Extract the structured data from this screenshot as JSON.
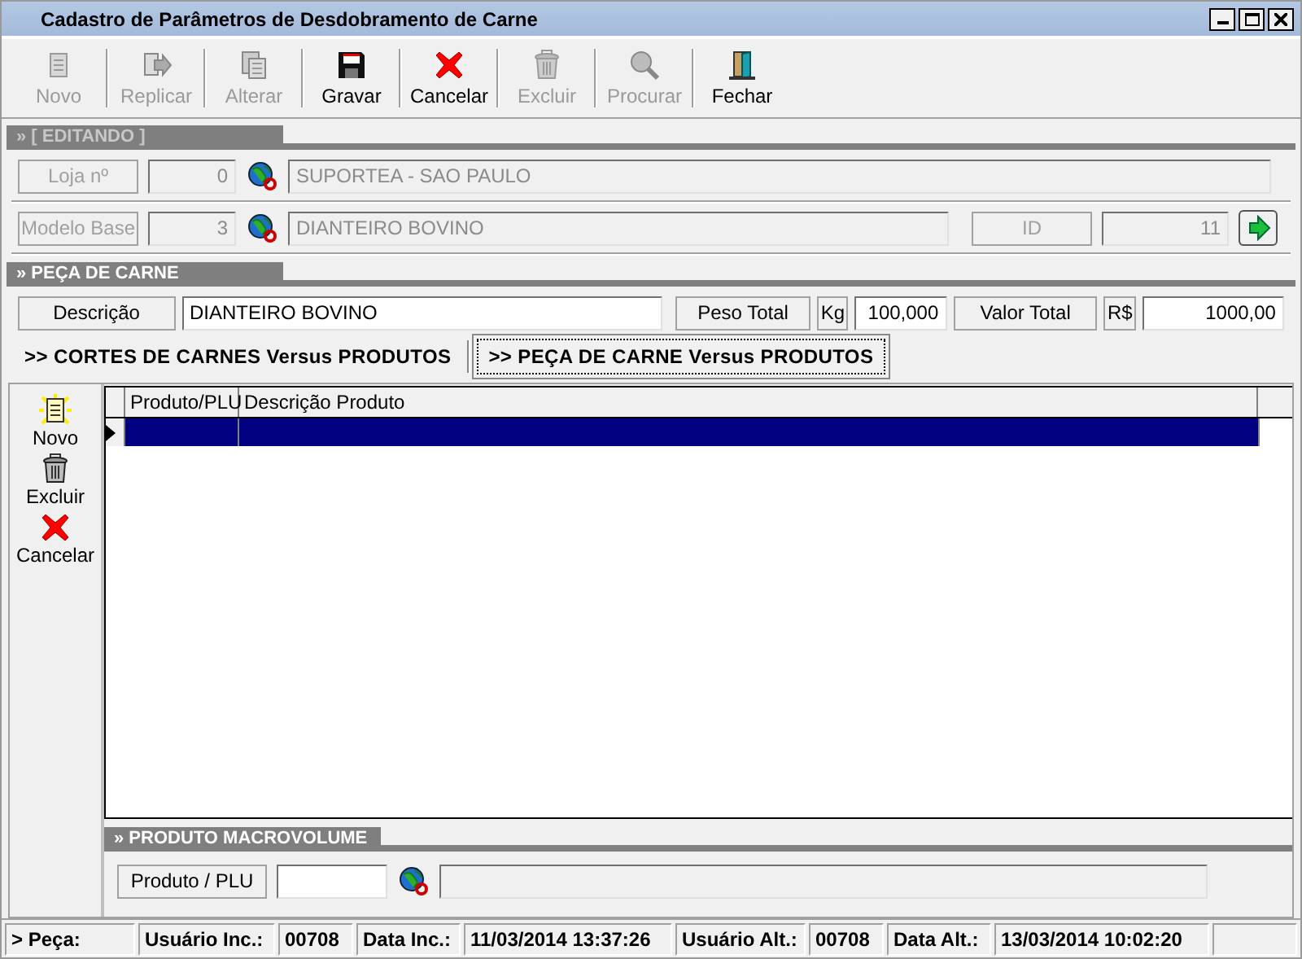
{
  "window": {
    "title": "Cadastro de Parâmetros de Desdobramento de Carne"
  },
  "toolbar": [
    {
      "label": "Novo",
      "disabled": true
    },
    {
      "label": "Replicar",
      "disabled": true
    },
    {
      "label": "Alterar",
      "disabled": true
    },
    {
      "label": "Gravar",
      "disabled": false
    },
    {
      "label": "Cancelar",
      "disabled": false
    },
    {
      "label": "Excluir",
      "disabled": true
    },
    {
      "label": "Procurar",
      "disabled": true
    },
    {
      "label": "Fechar",
      "disabled": false
    }
  ],
  "editing": {
    "title": "» [ EDITANDO ]",
    "disabled": true,
    "store": {
      "label": "Loja nº",
      "code": "0",
      "name": "SUPORTEA - SAO PAULO"
    },
    "model": {
      "label": "Modelo Base",
      "code": "3",
      "name": "DIANTEIRO BOVINO"
    },
    "id": {
      "label": "ID",
      "value": "11"
    }
  },
  "piece": {
    "title": "» PEÇA DE CARNE",
    "items": [
      {
        "kind": "label",
        "text": "Descrição"
      },
      {
        "kind": "field",
        "text": "DIANTEIRO BOVINO"
      },
      {
        "kind": "label",
        "text": "Peso Total"
      },
      {
        "kind": "unit",
        "text": "Kg"
      },
      {
        "kind": "number",
        "text": "100,000"
      },
      {
        "kind": "label",
        "text": "Valor Total"
      },
      {
        "kind": "unit",
        "text": "R$"
      },
      {
        "kind": "number",
        "text": "1000,00"
      }
    ]
  },
  "tabs": [
    {
      "label": ">> CORTES DE CARNES Versus PRODUTOS",
      "selected": false
    },
    {
      "label": ">> PEÇA DE CARNE Versus PRODUTOS",
      "selected": true
    }
  ],
  "side_actions": [
    {
      "label": "Novo"
    },
    {
      "label": "Excluir"
    },
    {
      "label": "Cancelar"
    }
  ],
  "grid": {
    "columns": [
      "Produto/PLU",
      "Descrição Produto"
    ],
    "rows": [
      {
        "selected": true
      }
    ]
  },
  "macrovolume": {
    "title": "» PRODUTO MACROVOLUME",
    "label": "Produto / PLU"
  },
  "status_bar": [
    "> Peça:",
    "Usuário Inc.:",
    "00708",
    "Data Inc.:",
    "11/03/2014 13:37:26",
    "Usuário Alt.:",
    "00708",
    "Data Alt.:",
    "13/03/2014 10:02:20"
  ]
}
